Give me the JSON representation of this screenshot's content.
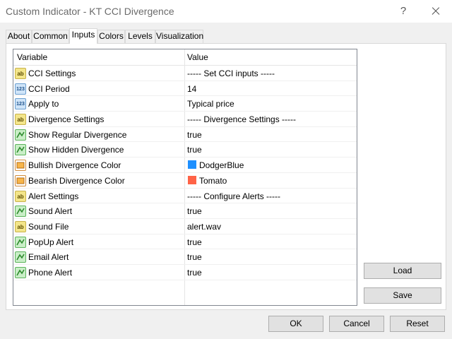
{
  "window": {
    "title": "Custom Indicator - KT CCI Divergence",
    "help_label": "?"
  },
  "tabs": [
    {
      "label": "About"
    },
    {
      "label": "Common"
    },
    {
      "label": "Inputs"
    },
    {
      "label": "Colors"
    },
    {
      "label": "Levels"
    },
    {
      "label": "Visualization"
    }
  ],
  "active_tab": "Inputs",
  "grid": {
    "columns": {
      "variable": "Variable",
      "value": "Value"
    },
    "rows": [
      {
        "icon": "ab",
        "variable": "CCI Settings",
        "value": "----- Set CCI inputs -----"
      },
      {
        "icon": "123",
        "variable": "CCI Period",
        "value": "14"
      },
      {
        "icon": "123",
        "variable": "Apply to",
        "value": "Typical price"
      },
      {
        "icon": "ab",
        "variable": "Divergence Settings",
        "value": "----- Divergence Settings -----"
      },
      {
        "icon": "bool",
        "variable": "Show Regular Divergence",
        "value": "true"
      },
      {
        "icon": "bool",
        "variable": "Show Hidden Divergence",
        "value": "true"
      },
      {
        "icon": "color",
        "variable": "Bullish Divergence Color",
        "value": "DodgerBlue",
        "color": "#1e90ff"
      },
      {
        "icon": "color",
        "variable": "Bearish Divergence Color",
        "value": "Tomato",
        "color": "#ff6347"
      },
      {
        "icon": "ab",
        "variable": "Alert Settings",
        "value": "----- Configure Alerts -----"
      },
      {
        "icon": "bool",
        "variable": "Sound Alert",
        "value": "true"
      },
      {
        "icon": "ab",
        "variable": "Sound File",
        "value": "alert.wav"
      },
      {
        "icon": "bool",
        "variable": "PopUp Alert",
        "value": "true"
      },
      {
        "icon": "bool",
        "variable": "Email Alert",
        "value": "true"
      },
      {
        "icon": "bool",
        "variable": "Phone Alert",
        "value": "true"
      }
    ]
  },
  "side_buttons": {
    "load": "Load",
    "save": "Save"
  },
  "footer_buttons": {
    "ok": "OK",
    "cancel": "Cancel",
    "reset": "Reset"
  }
}
